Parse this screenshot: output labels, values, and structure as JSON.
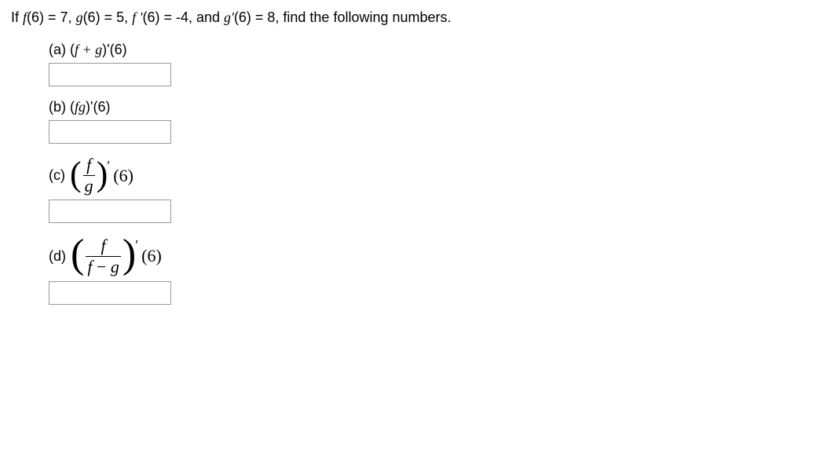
{
  "intro": {
    "text1": "If ",
    "f6": "f",
    "eq1": "(6) = 7, ",
    "g6": "g",
    "eq2": "(6) = 5, ",
    "fp6": "f '",
    "eq3": "(6) = -4, and ",
    "gp6": "g'",
    "eq4": "(6) = 8, find the following numbers."
  },
  "parts": {
    "a": {
      "label": "(a) (",
      "inner": "f + g",
      "after": ")'(6)"
    },
    "b": {
      "label": "(b) (",
      "inner": "fg",
      "after": ")'(6)"
    },
    "c": {
      "label": "(c)",
      "num": "f",
      "den": "g",
      "arg": "(6)"
    },
    "d": {
      "label": "(d)",
      "num": "f",
      "den_f": "f",
      "den_minus": " − ",
      "den_g": "g",
      "arg": "(6)"
    }
  }
}
